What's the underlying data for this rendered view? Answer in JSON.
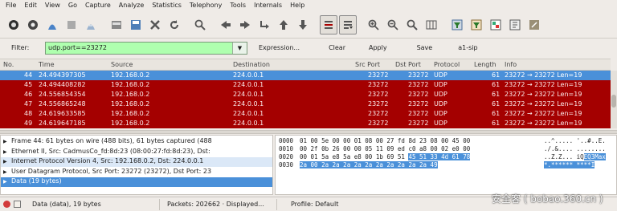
{
  "menu": [
    "File",
    "Edit",
    "View",
    "Go",
    "Capture",
    "Analyze",
    "Statistics",
    "Telephony",
    "Tools",
    "Internals",
    "Help"
  ],
  "toolbar": {
    "icons": [
      "interface-list-icon",
      "capture-options-icon",
      "start-capture-icon",
      "stop-capture-icon",
      "restart-capture-icon",
      "open-file-icon",
      "save-file-icon",
      "close-file-icon",
      "reload-icon",
      "find-icon",
      "go-back-icon",
      "go-forward-icon",
      "go-to-packet-icon",
      "go-first-icon",
      "go-last-icon",
      "colorize-icon",
      "auto-scroll-icon",
      "zoom-in-icon",
      "zoom-out-icon",
      "normal-size-icon",
      "resize-columns-icon",
      "capture-filters-icon",
      "display-filters-icon",
      "coloring-rules-icon",
      "preferences-icon",
      "help-icon"
    ]
  },
  "filter": {
    "label": "Filter:",
    "value": "udp.port==23272",
    "expression": "Expression...",
    "clear": "Clear",
    "apply": "Apply",
    "save": "Save",
    "extra": "a1-sip"
  },
  "packet_list": {
    "columns": [
      "No.",
      "Time",
      "Source",
      "Destination",
      "Src Port",
      "Dst Port",
      "Protocol",
      "Length",
      "Info"
    ],
    "rows": [
      {
        "no": "44",
        "time": "24.494397305",
        "src": "192.168.0.2",
        "dst": "224.0.0.1",
        "sport": "23272",
        "dport": "23272",
        "proto": "UDP",
        "len": "61",
        "info": "23272 → 23272  Len=19"
      },
      {
        "no": "45",
        "time": "24.494408282",
        "src": "192.168.0.2",
        "dst": "224.0.0.1",
        "sport": "23272",
        "dport": "23272",
        "proto": "UDP",
        "len": "61",
        "info": "23272 → 23272  Len=19"
      },
      {
        "no": "46",
        "time": "24.556854354",
        "src": "192.168.0.2",
        "dst": "224.0.0.1",
        "sport": "23272",
        "dport": "23272",
        "proto": "UDP",
        "len": "61",
        "info": "23272 → 23272  Len=19"
      },
      {
        "no": "47",
        "time": "24.556865248",
        "src": "192.168.0.2",
        "dst": "224.0.0.1",
        "sport": "23272",
        "dport": "23272",
        "proto": "UDP",
        "len": "61",
        "info": "23272 → 23272  Len=19"
      },
      {
        "no": "48",
        "time": "24.619633585",
        "src": "192.168.0.2",
        "dst": "224.0.0.1",
        "sport": "23272",
        "dport": "23272",
        "proto": "UDP",
        "len": "61",
        "info": "23272 → 23272  Len=19"
      },
      {
        "no": "49",
        "time": "24.619647185",
        "src": "192.168.0.2",
        "dst": "224.0.0.1",
        "sport": "23272",
        "dport": "23272",
        "proto": "UDP",
        "len": "61",
        "info": "23272 → 23272  Len=19"
      }
    ]
  },
  "details": [
    "Frame 44: 61 bytes on wire (488 bits), 61 bytes captured (488",
    "Ethernet II, Src: CadmusCo_fd:8d:23 (08:00:27:fd:8d:23), Dst:",
    "Internet Protocol Version 4, Src: 192.168.0.2, Dst: 224.0.0.1",
    "User Datagram Protocol, Src Port: 23272 (23272), Dst Port: 23",
    "Data (19 bytes)"
  ],
  "bytes": [
    {
      "off": "0000",
      "hex": "01 00 5e 00 00 01 08 00  27 fd 8d 23 08 00 45 00",
      "asc": "..^..... '..#..E."
    },
    {
      "off": "0010",
      "hex": "00 2f 0b 26 00 00 05 11  09 ed c0 a8 00 02 e0 00",
      "asc": "./.&.... ........"
    },
    {
      "off": "0020",
      "hex_a": "00 01 5a e8 5a e8 00 1b  69 51 ",
      "hex_b": "45 51 33 4d 61 78",
      "asc_a": "..Z.Z... iQ",
      "asc_b": "EQ3Max"
    },
    {
      "off": "0030",
      "hex_b": "2a 00 2a 2a 2a 2a 2a 2a  2a 2a 2a 2a 49",
      "asc_b": "*.****** ****I"
    }
  ],
  "status": {
    "data_label": "Data (data), 19 bytes",
    "packets": "Packets: 202662 · Displayed...",
    "profile": "Profile: Default"
  },
  "watermark": "安全客 ( bobao.360.cn )",
  "colors": {
    "row_bg": "#a40000",
    "selected": "#4a90d9",
    "filter_ok": "#afffaf"
  }
}
